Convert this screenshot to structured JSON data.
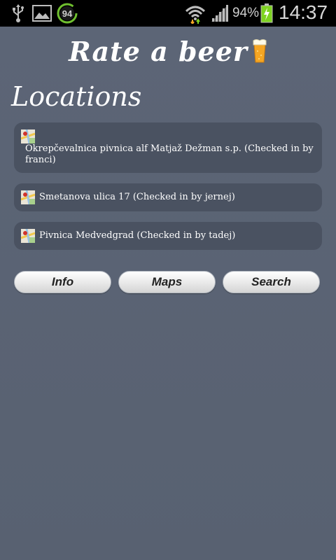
{
  "status_bar": {
    "badge_number": "94",
    "battery_percent": "94%",
    "time": "14:37",
    "icons": [
      "usb-icon",
      "gallery-icon",
      "battery-saver-badge-icon",
      "wifi-icon",
      "signal-icon",
      "battery-charging-icon"
    ]
  },
  "header": {
    "title": "Rate a beer",
    "icon": "beer-glass-icon"
  },
  "section": {
    "title": "Locations"
  },
  "locations": [
    {
      "label": "Okrepčevalnica pivnica alf Matjaž Dežman s.p. (Checked in by franci)",
      "icon": "map-icon"
    },
    {
      "label": "Smetanova ulica 17 (Checked in by jernej)",
      "icon": "map-icon"
    },
    {
      "label": "Pivnica Medvedgrad (Checked in by tadej)",
      "icon": "map-icon"
    }
  ],
  "buttons": {
    "info": "Info",
    "maps": "Maps",
    "search": "Search"
  },
  "colors": {
    "background": "#5a6373",
    "list_item_bg": "#4a5261",
    "status_bar": "#000000",
    "battery_green": "#7ed321"
  }
}
